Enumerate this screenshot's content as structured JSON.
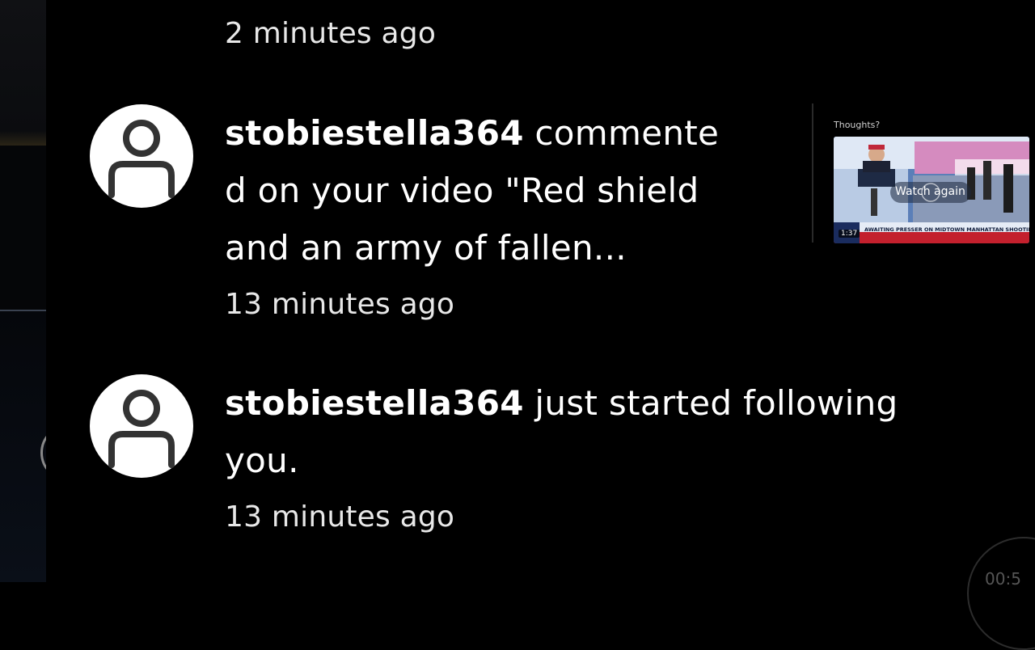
{
  "notifications": [
    {
      "time": "2 minutes ago"
    },
    {
      "username": "stobiestella364",
      "lines": [
        "commente",
        "d on your video \"Red shield",
        "and an army of fallen..."
      ],
      "time": "13 minutes ago",
      "thumbnail": {
        "title": "Thoughts?",
        "button_label": "Watch again",
        "duration": "1:37",
        "ticker": "AWAITING PRESSER ON MIDTOWN MANHATTAN SHOOTING"
      }
    },
    {
      "username": "stobiestella364",
      "lines": [
        "just started following",
        "you."
      ],
      "time": "13 minutes ago"
    }
  ],
  "player": {
    "time": "00:5"
  },
  "icons": {
    "avatar": "user-avatar-icon",
    "play": "play-icon"
  },
  "colors": {
    "background": "#000000",
    "text": "#ffffff",
    "avatar_bg": "#ffffff",
    "avatar_icon": "#333333"
  }
}
